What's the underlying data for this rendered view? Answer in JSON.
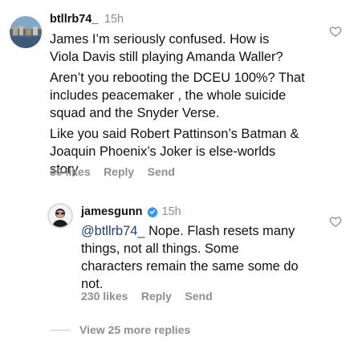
{
  "comment": {
    "username": "btllrb74_",
    "time": "15h",
    "paragraphs": [
      [
        "James I’m seriously confused.  How is",
        "Viola Davis still playing Amanda Waller?"
      ],
      [
        "Aren’t you rebooting the DCEU 100%? That",
        "includes peacemaker , the whole suicide",
        "squad and the Snyder Verse."
      ],
      [
        "Like you said Robert Pattinson’s Batman &",
        "Joaquin Phoenix’s Joker is else-worlds",
        "story."
      ]
    ],
    "likes": "30 likes",
    "reply_label": "Reply",
    "send_label": "Send",
    "icons": {
      "like": "heart-outline-icon"
    }
  },
  "reply": {
    "username": "jamesgunn",
    "time": "15h",
    "mention": "@btllrb74_",
    "lines": [
      " Nope. Flash resets many",
      "things, not all things. Some",
      "characters remain the same some do",
      "not."
    ],
    "likes": "230 likes",
    "reply_label": "Reply",
    "send_label": "Send",
    "icons": {
      "verified": "verified-badge-icon",
      "like": "heart-outline-icon"
    }
  },
  "view_more": "View 25 more replies",
  "colors": {
    "verified": "#3897f0",
    "mention": "#24406f",
    "secondary": "#8e8e8e"
  }
}
